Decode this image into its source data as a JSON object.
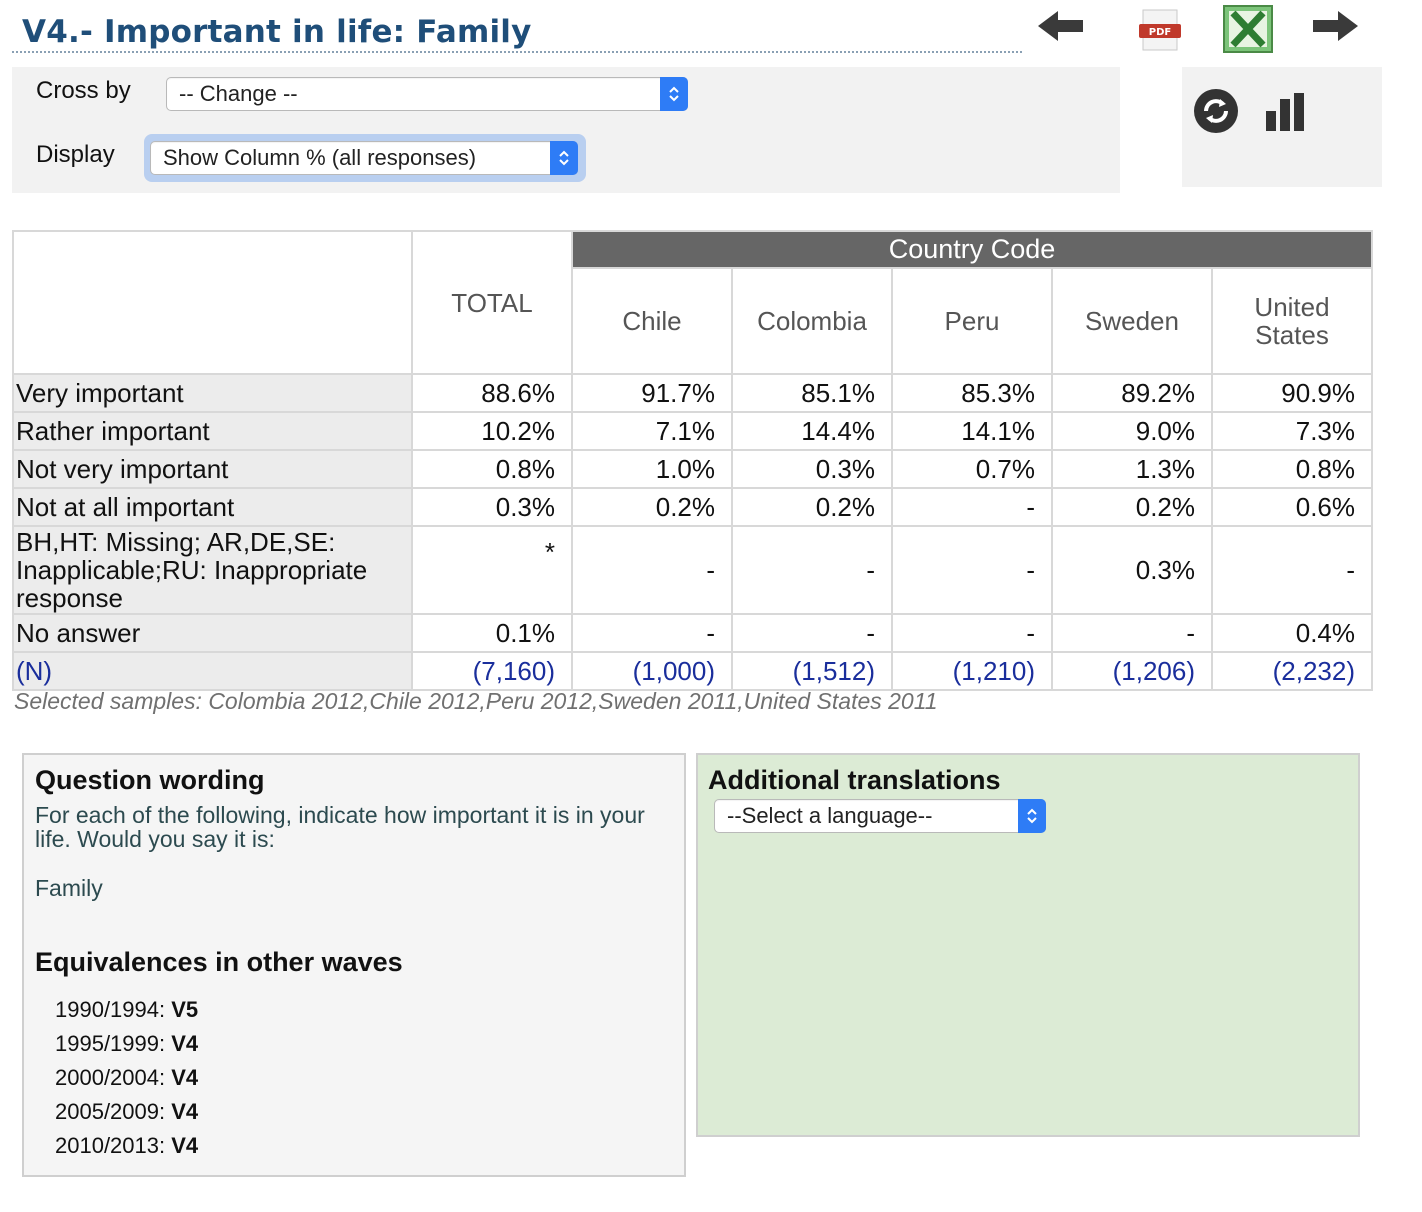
{
  "page": {
    "title": "V4.- Important in life: Family"
  },
  "options": {
    "cross_by_label": "Cross by",
    "cross_by_value": "-- Change --",
    "display_label": "Display",
    "display_value": "Show Column % (all responses)"
  },
  "icons": {
    "back": "arrow-left-icon",
    "pdf": "pdf-icon",
    "excel": "excel-icon",
    "forward": "arrow-right-icon",
    "refresh": "refresh-icon",
    "chart": "bar-chart-icon"
  },
  "table": {
    "group_header": "Country Code",
    "total_header": "TOTAL",
    "columns": [
      "Chile",
      "Colombia",
      "Peru",
      "Sweden",
      "United States"
    ],
    "rows": [
      {
        "label": "Very important",
        "total": "88.6%",
        "values": [
          "91.7%",
          "85.1%",
          "85.3%",
          "89.2%",
          "90.9%"
        ]
      },
      {
        "label": "Rather important",
        "total": "10.2%",
        "values": [
          "7.1%",
          "14.4%",
          "14.1%",
          "9.0%",
          "7.3%"
        ]
      },
      {
        "label": "Not very important",
        "total": "0.8%",
        "values": [
          "1.0%",
          "0.3%",
          "0.7%",
          "1.3%",
          "0.8%"
        ]
      },
      {
        "label": "Not at all important",
        "total": "0.3%",
        "values": [
          "0.2%",
          "0.2%",
          "-",
          "0.2%",
          "0.6%"
        ]
      },
      {
        "label": "BH,HT: Missing; AR,DE,SE: Inapplicable;RU: Inappropriate response",
        "total": "*",
        "values": [
          "-",
          "-",
          "-",
          "0.3%",
          "-"
        ]
      },
      {
        "label": "No answer",
        "total": "0.1%",
        "values": [
          "-",
          "-",
          "-",
          "-",
          "0.4%"
        ]
      }
    ],
    "n_row": {
      "label": "(N)",
      "total": "(7,160)",
      "values": [
        "(1,000)",
        "(1,512)",
        "(1,210)",
        "(1,206)",
        "(2,232)"
      ]
    }
  },
  "samples_note": "Selected samples: Colombia 2012,Chile 2012,Peru 2012,Sweden 2011,United States 2011",
  "question": {
    "heading": "Question wording",
    "text": "For each of the following, indicate how important it is in your life. Would you say it is:",
    "item": "Family"
  },
  "equivalences": {
    "heading": "Equivalences in other waves",
    "items": [
      {
        "wave": "1990/1994:",
        "code": "V5"
      },
      {
        "wave": "1995/1999:",
        "code": "V4"
      },
      {
        "wave": "2000/2004:",
        "code": "V4"
      },
      {
        "wave": "2005/2009:",
        "code": "V4"
      },
      {
        "wave": "2010/2013:",
        "code": "V4"
      }
    ]
  },
  "translations": {
    "heading": "Additional translations",
    "select_value": "--Select a language--"
  }
}
